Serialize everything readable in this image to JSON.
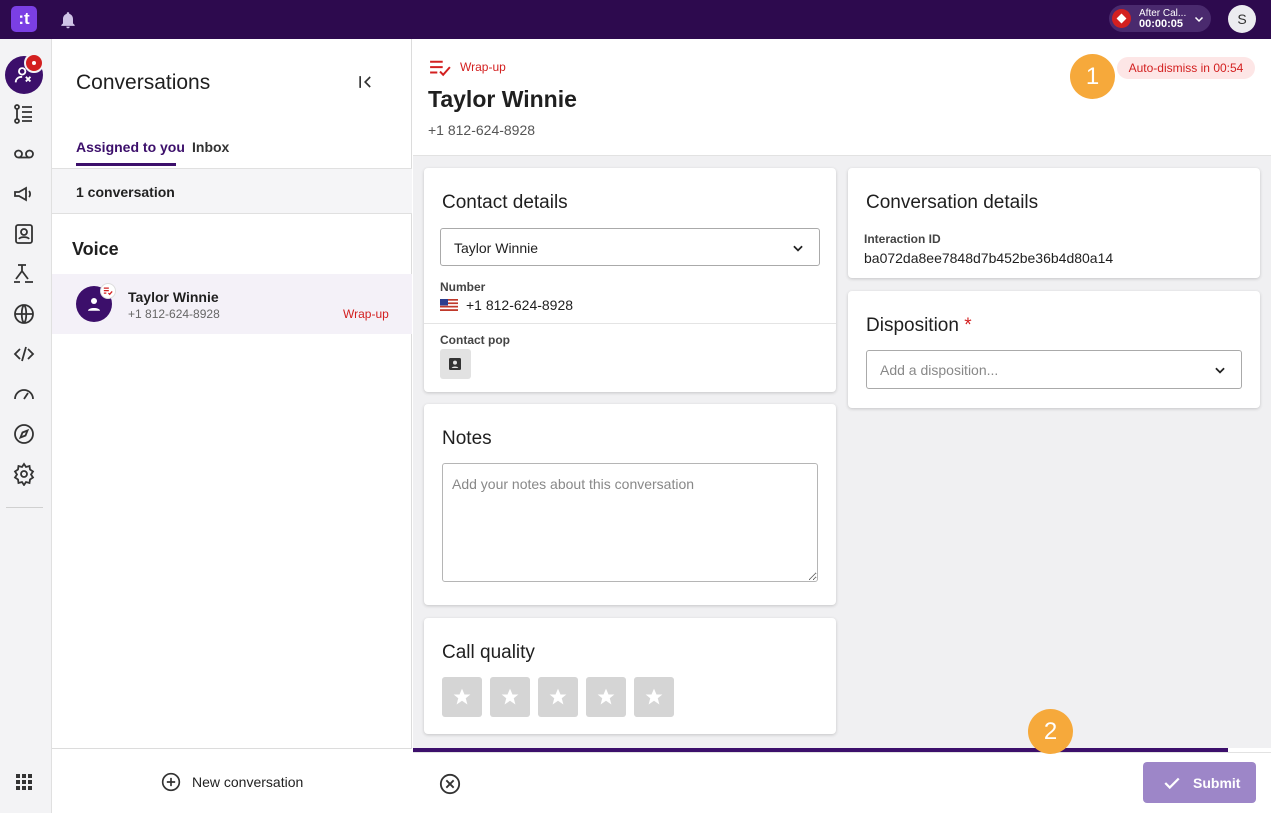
{
  "topbar": {
    "logo_text": ":t",
    "status_label": "After Cal...",
    "status_timer": "00:00:05",
    "user_initial": "S"
  },
  "rail": {
    "items": [
      "agent-icon",
      "queue-list-icon",
      "voicemail-icon",
      "campaigns-icon",
      "contacts-icon",
      "workflows-icon",
      "globe-icon",
      "code-icon",
      "dashboard-icon",
      "explore-icon",
      "settings-icon",
      "apps-grid-icon"
    ]
  },
  "conversations": {
    "title": "Conversations",
    "tabs": [
      {
        "label": "Assigned to you",
        "active": true
      },
      {
        "label": "Inbox",
        "active": false
      }
    ],
    "count_label": "1 conversation",
    "section_label": "Voice",
    "items": [
      {
        "name": "Taylor Winnie",
        "phone": "+1 812-624-8928",
        "status": "Wrap-up"
      }
    ],
    "new_conversation_label": "New conversation"
  },
  "header": {
    "state_label": "Wrap-up",
    "contact_name": "Taylor Winnie",
    "contact_phone": "+1 812-624-8928",
    "auto_dismiss": "Auto-dismiss in 00:54"
  },
  "callouts": {
    "one": "1",
    "two": "2"
  },
  "contact_details": {
    "title": "Contact details",
    "selected_contact": "Taylor Winnie",
    "number_label": "Number",
    "number_value": "+1 812-624-8928",
    "contact_pop_label": "Contact pop"
  },
  "notes": {
    "title": "Notes",
    "placeholder": "Add your notes about this conversation"
  },
  "call_quality": {
    "title": "Call quality",
    "rating": 0,
    "max_rating": 5
  },
  "conversation_details": {
    "title": "Conversation details",
    "interaction_label": "Interaction ID",
    "interaction_id": "ba072da8ee7848d7b452be36b4d80a14"
  },
  "disposition": {
    "title": "Disposition",
    "required_mark": "*",
    "placeholder": "Add a disposition..."
  },
  "footer": {
    "submit_label": "Submit",
    "wrapup_progress_pct": 95
  },
  "colors": {
    "brand": "#3c0f6b",
    "topbar": "#2d0a4e",
    "alert": "#d32020",
    "callout": "#f6a93b",
    "submit_disabled": "#9d86c8"
  }
}
